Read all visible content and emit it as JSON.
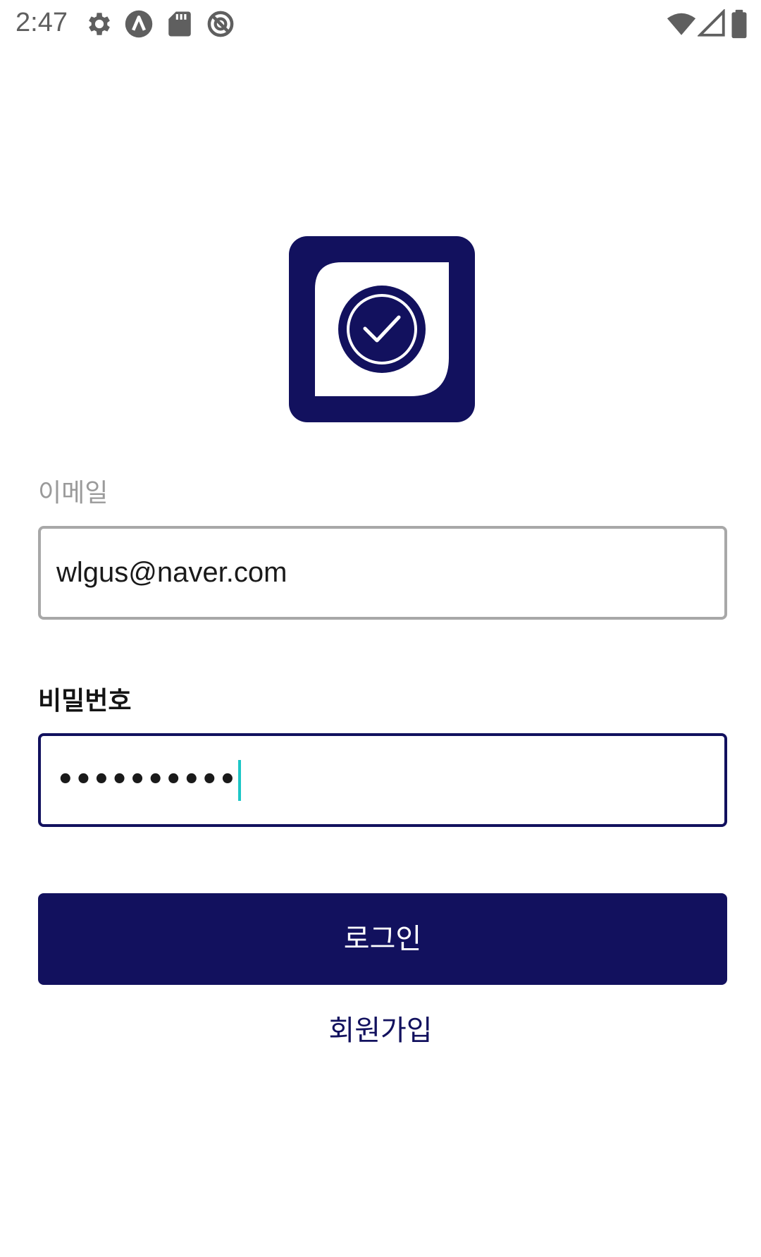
{
  "status_bar": {
    "time": "2:47",
    "left_icons": [
      "settings-icon",
      "app-notification-icon",
      "sd-card-icon",
      "do-not-disturb-icon"
    ],
    "right_icons": [
      "wifi-icon",
      "cellular-signal-icon",
      "battery-icon"
    ]
  },
  "logo": {
    "icon": "check-circle-icon",
    "brand_color": "#12115e"
  },
  "email": {
    "label": "이메일",
    "value": "wlgus@naver.com"
  },
  "password": {
    "label": "비밀번호",
    "masked_value": "••••••••••"
  },
  "actions": {
    "login_label": "로그인",
    "signup_label": "회원가입"
  },
  "colors": {
    "primary": "#12115e",
    "cursor": "#1cc6c6",
    "inactive_border": "#a8a8a8"
  }
}
